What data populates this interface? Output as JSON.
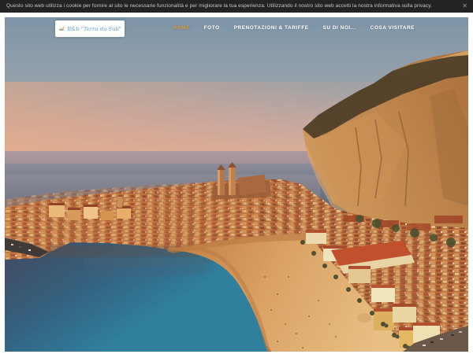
{
  "cookie_banner": {
    "message": "Questo sito web utilizza i cookie per fornire al sito le necessarie funzionalità e per migliorare la tua esperienza. Utilizzando il nostro sito web accetti la nostra informativa sulla privacy.",
    "close_label": "✕"
  },
  "header": {
    "brand": "B&b \"Terra du Suli\"",
    "active_item": "HOME",
    "nav_items": [
      {
        "label": "HOME"
      },
      {
        "label": "FOTO"
      },
      {
        "label": "PRENOTAZIONI & TARIFFE"
      },
      {
        "label": "SU DI NOI..."
      },
      {
        "label": "COSA VISITARE"
      }
    ]
  },
  "hero": {
    "description": "Sunset aerial view of Cefalù, Sicily: old town and cathedral beneath La Rocca cliff, curved bay with pier, golden beach and seafront promenade"
  },
  "colors": {
    "cookie_bar_bg": "#232323",
    "cookie_text": "#c9c9c9",
    "nav_link": "#ffffff",
    "nav_active": "#d89b3c",
    "brand_text": "#5b9ec7"
  }
}
